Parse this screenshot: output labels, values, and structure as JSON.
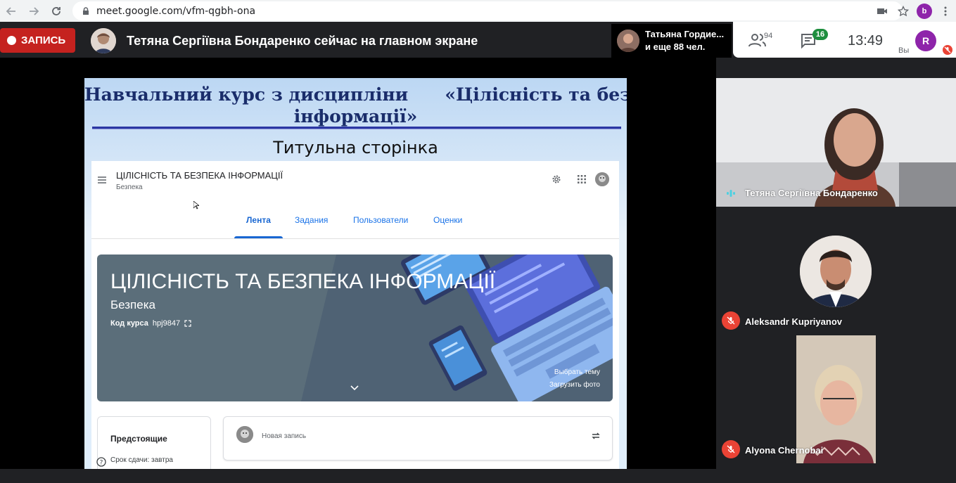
{
  "browser": {
    "url": "meet.google.com/vfm-qgbh-ona",
    "profile_initial": "b"
  },
  "meet_header": {
    "recording_label": "ЗАПИСЬ",
    "presenter_text": "Тетяна Сергіївна Бондаренко сейчас на главном экране",
    "others_line1": "Татьяна Гордие...",
    "others_line2": "и еще 88 чел.",
    "people_count": "94",
    "chat_badge": "16",
    "time": "13:49",
    "you_label": "Вы",
    "user_initial": "R"
  },
  "slide": {
    "title_line1": "Навчальний курс з дисципліни      «Цілісність та безпека",
    "title_line2": "інформації»",
    "subtitle": "Титульна сторінка"
  },
  "classroom": {
    "course_title": "ЦІЛІСНІСТЬ ТА БЕЗПЕКА ІНФОРМАЦІЇ",
    "course_subtitle": "Безпека",
    "tabs": [
      "Лента",
      "Задания",
      "Пользователи",
      "Оценки"
    ],
    "active_tab": "Лента",
    "banner": {
      "title": "ЦІЛІСНІСТЬ ТА БЕЗПЕКА ІНФОРМАЦІЇ",
      "subtitle": "Безпека",
      "code_label": "Код курса",
      "code_value": "hpj9847",
      "choose_theme": "Выбрать тему",
      "upload_photo": "Загрузить фото"
    },
    "upcoming_title": "Предстоящие",
    "upcoming_due": "Срок сдачи: завтра",
    "new_post_placeholder": "Новая запись"
  },
  "participants": [
    {
      "name": "Тетяна Сергіївна Бондаренко",
      "muted": false
    },
    {
      "name": "Aleksandr Kupriyanov",
      "muted": true
    },
    {
      "name": "Alyona Chernobai",
      "muted": true
    }
  ],
  "colors": {
    "record_red": "#c5221f",
    "meet_dark": "#202124",
    "chat_badge_green": "#1e8e3e",
    "classroom_blue": "#1967d2",
    "banner_slate": "#5b6e7a",
    "mute_red": "#ea4335"
  }
}
